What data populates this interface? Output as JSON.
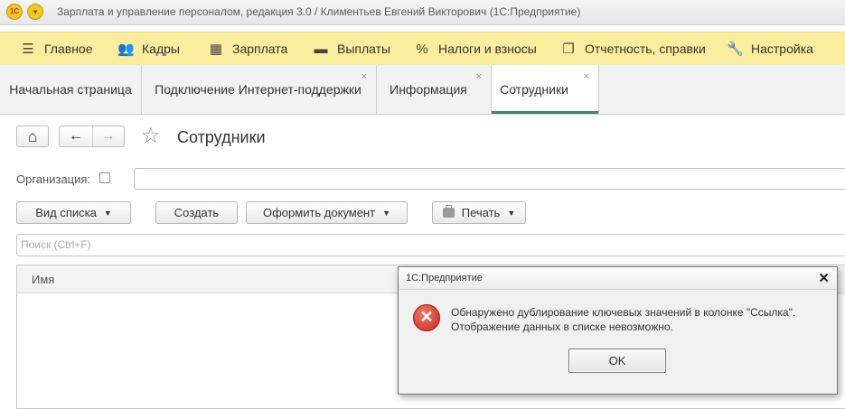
{
  "window": {
    "title": "Зарплата и управление персоналом, редакция 3.0 / Климентьев Евгений Викторович  (1С:Предприятие)",
    "logo_text": "1C",
    "menu_glyph": "▾"
  },
  "sections": [
    {
      "label": "Главное",
      "icon": "menu-icon",
      "glyph": "☰"
    },
    {
      "label": "Кадры",
      "icon": "people-icon",
      "glyph": "👥"
    },
    {
      "label": "Зарплата",
      "icon": "calculator-icon",
      "glyph": "▦"
    },
    {
      "label": "Выплаты",
      "icon": "wallet-icon",
      "glyph": "▬"
    },
    {
      "label": "Налоги и взносы",
      "icon": "percent-icon",
      "glyph": "%"
    },
    {
      "label": "Отчетность, справки",
      "icon": "reports-icon",
      "glyph": "❐"
    },
    {
      "label": "Настройка",
      "icon": "wrench-icon",
      "glyph": "🔧"
    }
  ],
  "tabs": [
    {
      "label": "Начальная страница",
      "closable": false,
      "active": false
    },
    {
      "label": "Подключение Интернет-поддержки",
      "closable": true,
      "active": false
    },
    {
      "label": "Информация",
      "closable": true,
      "active": false
    },
    {
      "label": "Сотрудники",
      "closable": true,
      "active": true
    }
  ],
  "tab_close_glyph": "×",
  "page": {
    "title": "Сотрудники",
    "home_glyph": "⌂",
    "back_glyph": "←",
    "forward_glyph": "→",
    "star_glyph": "☆"
  },
  "filter": {
    "org_label": "Организация:",
    "org_value": ""
  },
  "toolbar": {
    "view_list": "Вид списка",
    "create": "Создать",
    "make_document": "Оформить документ",
    "print": "Печать",
    "dropdown_glyph": "▼"
  },
  "search": {
    "placeholder": "Поиск (Ctrl+F)"
  },
  "list": {
    "columns": [
      "Имя"
    ]
  },
  "dialog": {
    "title": "1С:Предприятие",
    "close_glyph": "✕",
    "error_glyph": "✕",
    "message_line1": "Обнаружено дублирование ключевых значений в колонке \"Ссылка\".",
    "message_line2": "Отображение данных в списке невозможно.",
    "ok": "OK"
  },
  "colors": {
    "sections_bg": "#fbed9e",
    "active_tab_underline": "#3a8b64",
    "error_red": "#c9261c"
  }
}
